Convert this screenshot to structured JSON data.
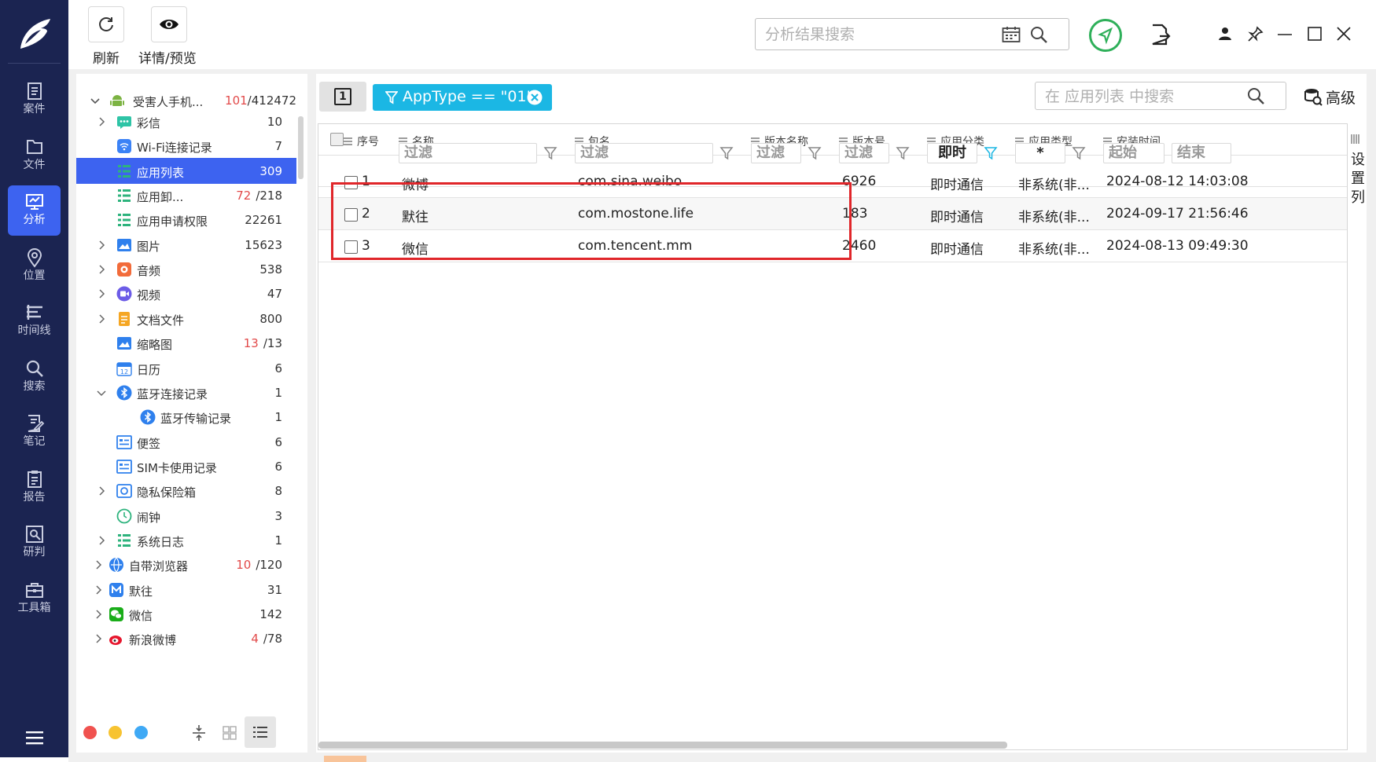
{
  "nav": {
    "items": [
      {
        "label": "案件",
        "icon": "case-icon"
      },
      {
        "label": "文件",
        "icon": "folder-icon"
      },
      {
        "label": "分析",
        "icon": "analysis-icon",
        "active": true
      },
      {
        "label": "位置",
        "icon": "location-icon"
      },
      {
        "label": "时间线",
        "icon": "timeline-icon"
      },
      {
        "label": "搜索",
        "icon": "search-icon"
      },
      {
        "label": "笔记",
        "icon": "note-icon"
      },
      {
        "label": "报告",
        "icon": "report-icon"
      },
      {
        "label": "研判",
        "icon": "judge-icon"
      },
      {
        "label": "工具箱",
        "icon": "toolbox-icon"
      }
    ]
  },
  "toolbar": {
    "refresh_label": "刷新",
    "details_label": "详情/预览",
    "search_placeholder": "分析结果搜索"
  },
  "tree": {
    "root": {
      "label": "受害人手机...",
      "count_red": "101",
      "count_total": "/412472"
    },
    "items": [
      {
        "label": "彩信",
        "count": "10"
      },
      {
        "label": "Wi-Fi连接记录",
        "count": "7"
      },
      {
        "label": "应用列表",
        "count": "309"
      },
      {
        "label": "应用卸...",
        "count_red": "72",
        "count_total": "/218"
      },
      {
        "label": "应用申请权限",
        "count": "22261"
      },
      {
        "label": "图片",
        "count": "15623"
      },
      {
        "label": "音频",
        "count": "538"
      },
      {
        "label": "视频",
        "count": "47"
      },
      {
        "label": "文档文件",
        "count": "800"
      },
      {
        "label": "缩略图",
        "count_red": "13",
        "count_total": "/13"
      },
      {
        "label": "日历",
        "count": "6"
      },
      {
        "label": "蓝牙连接记录",
        "count": "1"
      },
      {
        "label": "蓝牙传输记录",
        "count": "1"
      },
      {
        "label": "便签",
        "count": "6"
      },
      {
        "label": "SIM卡使用记录",
        "count": "6"
      },
      {
        "label": "隐私保险箱",
        "count": "8"
      },
      {
        "label": "闹钟",
        "count": "3"
      },
      {
        "label": "系统日志",
        "count": "1"
      },
      {
        "label": "自带浏览器",
        "count_red": "10",
        "count_total": "/120"
      },
      {
        "label": "默往",
        "count": "31"
      },
      {
        "label": "微信",
        "count": "142"
      },
      {
        "label": "新浪微博",
        "count_red": "4",
        "count_total": "/78"
      }
    ]
  },
  "filter_bar": {
    "page_num": "1",
    "chip_label": "AppType == \"01\"",
    "search_placeholder": "在 应用列表 中搜索",
    "advanced_label": "高级"
  },
  "table": {
    "columns": [
      "序号",
      "名称",
      "包名",
      "版本名称",
      "版本号",
      "应用分类",
      "应用类型",
      "安装时间"
    ],
    "filters": {
      "filter_placeholder": "过滤",
      "category_value": "即时",
      "type_value": "*",
      "start_label": "起始",
      "end_label": "结束"
    },
    "rows": [
      {
        "index": "1",
        "name": "微博",
        "package": "com.sina.weibo",
        "version_name": "",
        "version_code": "6926",
        "category": "即时通信",
        "type": "非系统(非...",
        "install_time": "2024-08-12 14:03:08"
      },
      {
        "index": "2",
        "name": "默往",
        "package": "com.mostone.life",
        "version_name": "",
        "version_code": "183",
        "category": "即时通信",
        "type": "非系统(非...",
        "install_time": "2024-09-17 21:56:46"
      },
      {
        "index": "3",
        "name": "微信",
        "package": "com.tencent.mm",
        "version_name": "",
        "version_code": "2460",
        "category": "即时通信",
        "type": "非系统(非...",
        "install_time": "2024-08-13 09:49:30"
      }
    ],
    "settings_label": "设置列"
  },
  "colors": {
    "nav_bg": "#1b2451",
    "accent": "#3d63f0",
    "chip": "#1bb7e4",
    "highlight_box": "#e0262a"
  }
}
